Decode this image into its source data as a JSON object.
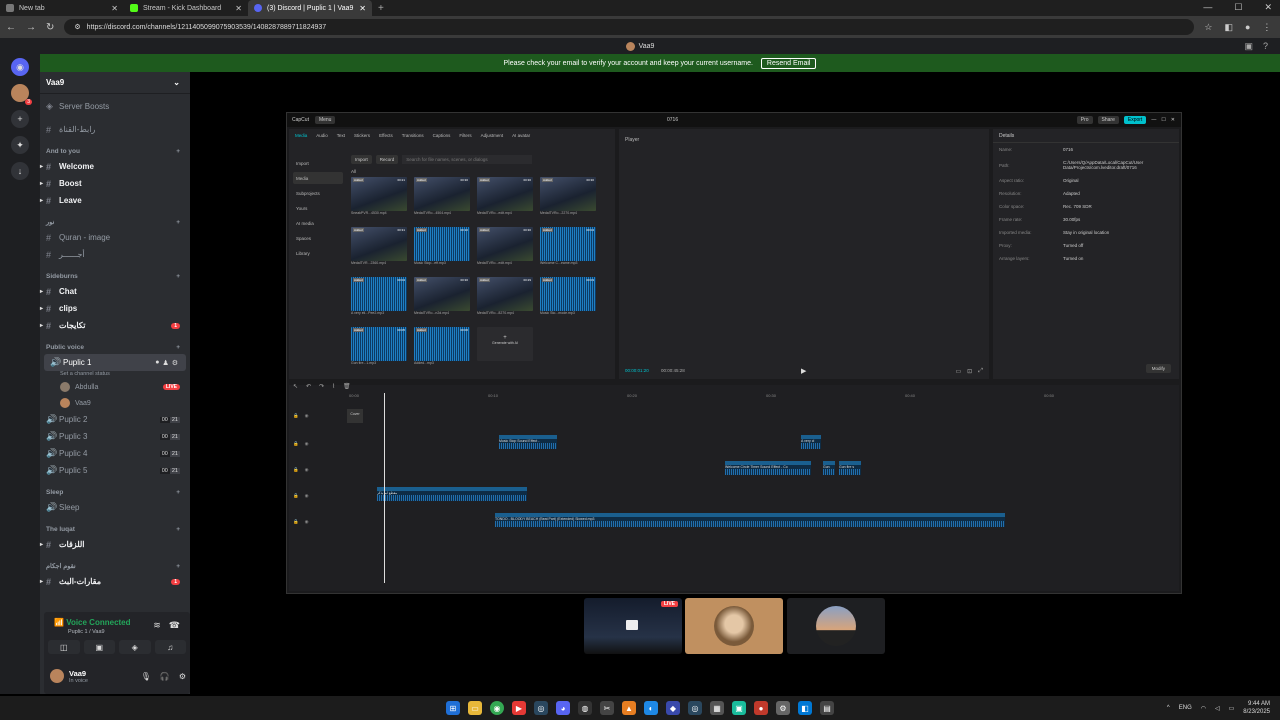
{
  "browser": {
    "tabs": [
      {
        "label": "New tab"
      },
      {
        "label": "Stream - Kick Dashboard"
      },
      {
        "label": "(3) Discord | Puplic 1 | Vaa9"
      }
    ],
    "url": "https://discord.com/channels/1211405099075903539/1408287889711824937"
  },
  "discord": {
    "window_title": "Vaa9",
    "banner": {
      "text": "Please check your email to verify your account and keep your current username.",
      "button": "Resend Email"
    },
    "server": {
      "name": "Vaa9"
    },
    "sidebar": {
      "server_boosts": "Server Boosts",
      "top_channel": "رابط-القناة",
      "cat_and_to_you": "And to you",
      "welcome": "Welcome",
      "boost": "Boost",
      "leave": "Leave",
      "cat_ar1": "نور",
      "quran": "Quran - image",
      "ar_channel2": "أجــــــر",
      "cat_sideburns": "Sideburns",
      "chat": "Chat",
      "clips": "clips",
      "ar_channel3": "تكايجات",
      "ar_channel3_badge": "1",
      "cat_public_voice": "Public voice",
      "puplic1": "Puplic 1",
      "set_status": "Set a channel status",
      "user_abdulla": "Abdulla",
      "live": "LIVE",
      "user_vaa9": "Vaa9",
      "puplic2": "Puplic 2",
      "puplic3": "Puplic 3",
      "puplic4": "Puplic 4",
      "puplic5": "Puplic 5",
      "count_a": "00",
      "count_b": "21",
      "cat_sleep": "Sleep",
      "sleep": "Sleep",
      "cat_luqat": "The luqat",
      "ar_channel4": "اللزقات",
      "cat_ar5": "نقوم اجكام",
      "ar_channel5": "مقارات-البث",
      "ar_channel5_badge": "1"
    },
    "voice": {
      "status": "Voice Connected",
      "sub": "Puplic 1 / Vaa9"
    },
    "user": {
      "name": "Vaa9",
      "status": "In voice"
    }
  },
  "capcut": {
    "logo": "CapCut",
    "menu": "Menu",
    "project": "0716",
    "pro": "Pro",
    "share": "Share",
    "export": "Export",
    "tabs": [
      "Media",
      "Audio",
      "Text",
      "Stickers",
      "Effects",
      "Transitions",
      "Captions",
      "Filters",
      "Adjustment",
      "AI avatar"
    ],
    "left_menu": [
      "Import",
      "Media",
      "Subprojects",
      "Yours",
      "AI media",
      "Spaces",
      "Library"
    ],
    "import_btn": "Import",
    "record_btn": "Record",
    "search": "Search for file names, scenes, or dialogs",
    "all": "All",
    "added": "Added",
    "thumbs": [
      {
        "name": "SneakPVR...4530.mp4",
        "dur": "00:21",
        "kind": "game"
      },
      {
        "name": "MedalTVRo...4504.mp4",
        "dur": "00:30",
        "kind": "game"
      },
      {
        "name": "MedalTVRo...edit.mp4",
        "dur": "00:30",
        "kind": "game"
      },
      {
        "name": "MedalTVRo...2270.mp4",
        "dur": "00:30",
        "kind": "game"
      },
      {
        "name": "MedalTVR...2360.mp4",
        "dur": "00:31",
        "kind": "game"
      },
      {
        "name": "Music Stop...eff.mp3",
        "dur": "00:10",
        "kind": "wave"
      },
      {
        "name": "MedalTVRo...edit.mp4",
        "dur": "00:30",
        "kind": "game"
      },
      {
        "name": "Welcome C...eame.mp3",
        "dur": "00:04",
        "kind": "wave"
      },
      {
        "name": "A very eli...Pee2.mp3",
        "dur": "00:04",
        "kind": "wave"
      },
      {
        "name": "MedalTVRo...n2d.mp4",
        "dur": "00:30",
        "kind": "game"
      },
      {
        "name": "MedalTVRo...8270.mp4",
        "dur": "00:29",
        "kind": "game"
      },
      {
        "name": "Music Sto...mode.mp3",
        "dur": "00:03",
        "kind": "wave"
      },
      {
        "name": "Gun fire...1.mp3",
        "dur": "00:05",
        "kind": "wave"
      },
      {
        "name": "Added...mp3",
        "dur": "00:06",
        "kind": "wave"
      }
    ],
    "generate": "Generate with AI",
    "player": {
      "title": "Player",
      "time_current": "00:00:01:20",
      "time_total": "00:00:45:28"
    },
    "details": {
      "title": "Details",
      "rows": [
        {
          "k": "Name:",
          "v": "0716"
        },
        {
          "k": "Path:",
          "v": "C:/Users/Q/AppData/Local/CapCut/User Data/Projects/com.lveditor.draft/0716"
        },
        {
          "k": "Aspect ratio:",
          "v": "Original"
        },
        {
          "k": "Resolution:",
          "v": "Adapted"
        },
        {
          "k": "Color space:",
          "v": "Rec. 709 SDR"
        },
        {
          "k": "Frame rate:",
          "v": "30.00fps"
        },
        {
          "k": "Imported media:",
          "v": "Stay in original location"
        },
        {
          "k": "Proxy:",
          "v": "Turned off"
        },
        {
          "k": "Arrange layers:",
          "v": "Turned on"
        }
      ],
      "modify": "Modify"
    },
    "timeline": {
      "ruler": [
        "00:00",
        "00:10",
        "00:20",
        "00:30",
        "00:40",
        "00:50"
      ],
      "cover": "Cover",
      "clips": [
        {
          "label": "Music Stop Sound Effect -"
        },
        {
          "label": "A very cl"
        },
        {
          "label": "Welcome Circle Timer Sound Effect - Co"
        },
        {
          "label": "Gun"
        },
        {
          "label": "Gun fire s"
        },
        {
          "label": "مقطع لم يذكر"
        },
        {
          "label": "TONDO - BLOODY BEACH (Beat Part) (Extended) Slowed.mp3"
        }
      ]
    }
  },
  "tiles": {
    "live": "LIVE"
  },
  "taskbar": {
    "lang": "ENG",
    "time": "9:44 AM",
    "date": "8/23/2025"
  }
}
